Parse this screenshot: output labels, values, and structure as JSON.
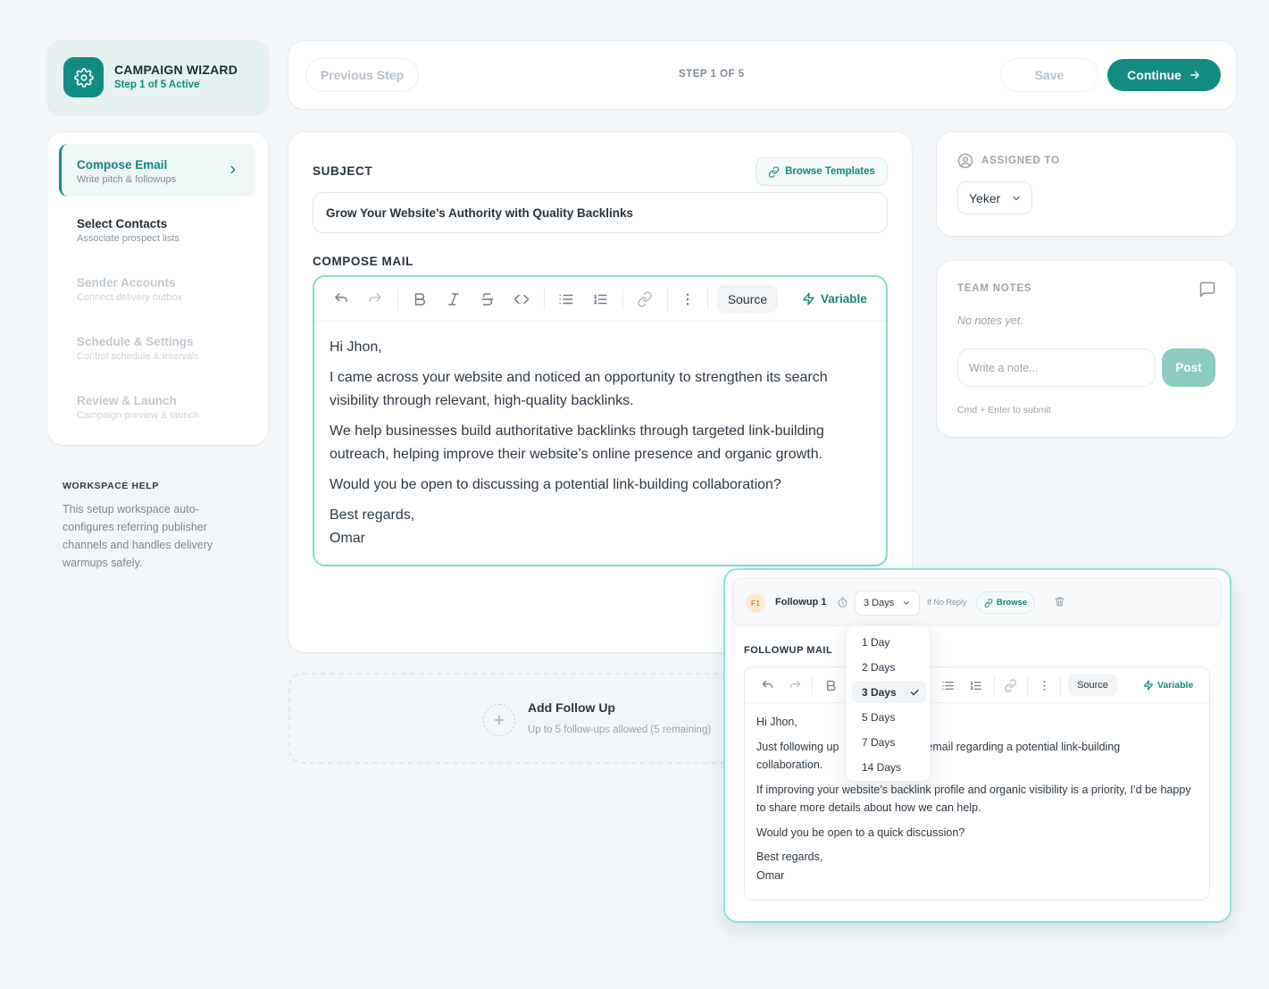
{
  "brand": {
    "title": "CAMPAIGN WIZARD",
    "subtitle": "Step 1 of 5 Active",
    "icon": "gear-icon"
  },
  "topbar": {
    "previous_label": "Previous Step",
    "step_label": "STEP 1 OF 5",
    "save_label": "Save",
    "continue_label": "Continue"
  },
  "sidebar": {
    "items": [
      {
        "label": "Compose Email",
        "description": "Write pitch & followups",
        "state": "active"
      },
      {
        "label": "Select Contacts",
        "description": "Associate prospect lists",
        "state": "next"
      },
      {
        "label": "Sender Accounts",
        "description": "Connect delivery outbox",
        "state": "disabled"
      },
      {
        "label": "Schedule & Settings",
        "description": "Control schedule & intervals",
        "state": "disabled"
      },
      {
        "label": "Review & Launch",
        "description": "Campaign preview & launch",
        "state": "disabled"
      }
    ]
  },
  "help": {
    "title": "WORKSPACE HELP",
    "text": "This setup workspace auto-configures referring publisher channels and handles delivery warmups safely."
  },
  "compose": {
    "subject_label": "SUBJECT",
    "browse_templates_label": "Browse Templates",
    "subject_value": "Grow Your Website’s Authority with Quality Backlinks",
    "compose_label": "COMPOSE MAIL",
    "source_label": "Source",
    "variable_label": "Variable",
    "body": [
      "Hi Jhon,",
      "I came across your website and noticed an opportunity to strengthen its search visibility through relevant, high-quality backlinks.",
      "We help businesses build authoritative backlinks through targeted link-building outreach, helping improve their website’s online presence and organic growth.",
      "Would you be open to discussing a potential link-building collaboration?",
      "Best regards,",
      "Omar"
    ]
  },
  "add_follow_up": {
    "title": "Add Follow Up",
    "subtitle": "Up to 5 follow-ups allowed (5 remaining)"
  },
  "assigned": {
    "label": "ASSIGNED TO",
    "value": "Yeker"
  },
  "notes": {
    "label": "TEAM NOTES",
    "empty": "No notes yet.",
    "placeholder": "Write a note...",
    "post_label": "Post",
    "hint": "Cmd + Enter to submit"
  },
  "followup": {
    "badge": "F1",
    "title": "Followup 1",
    "delay_value": "3 Days",
    "condition": "If No Reply",
    "browse_label": "Browse",
    "mail_label": "FOLLOWUP MAIL",
    "source_label": "Source",
    "variable_label": "Variable",
    "body": [
      "Hi Jhon,",
      "If improving your website’s backlink profile and organic visibility is a priority, I’d be happy to share more details about how we can help.",
      "Would you be open to a quick discussion?",
      "Best regards,",
      "Omar"
    ],
    "body_line2_left": "Just following up",
    "body_line2_right": "email regarding a potential link-building",
    "body_line3": "collaboration.",
    "delay_options": [
      "1 Day",
      "2 Days",
      "3 Days",
      "5 Days",
      "7 Days",
      "14 Days"
    ],
    "delay_selected_index": 2
  },
  "colors": {
    "accent": "#138c80",
    "accent_light": "#8fe3d7",
    "background": "#f3f6f8"
  }
}
